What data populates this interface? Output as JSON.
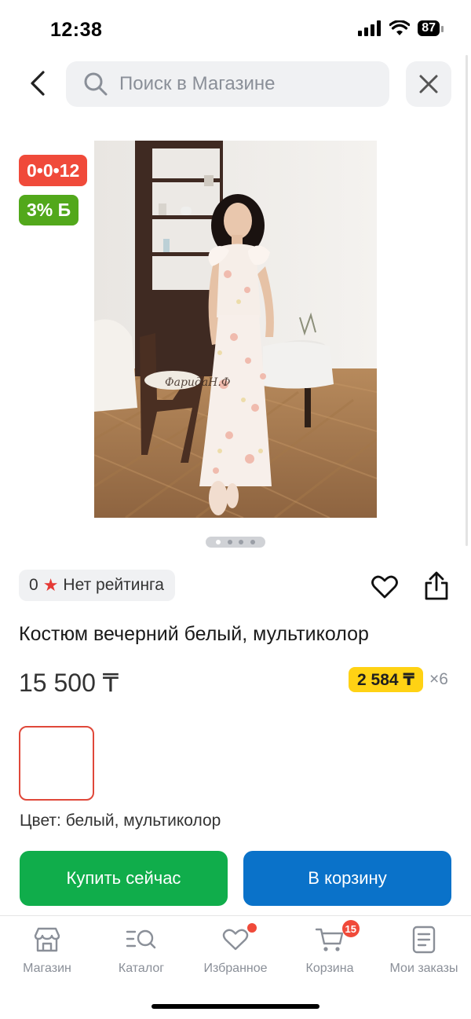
{
  "status_bar": {
    "time": "12:38",
    "battery": "87"
  },
  "search": {
    "placeholder": "Поиск в Магазине"
  },
  "badges": {
    "timer": "0•0•12",
    "bonus": "3% Б"
  },
  "product_image": {
    "watermark": "ФаридаН.Ф",
    "slides_total": 4,
    "active_slide": 1
  },
  "rating": {
    "count": "0",
    "text": "Нет рейтинга"
  },
  "product": {
    "title": "Костюм вечерний белый, мультиколор",
    "price": "15 500 ₸",
    "installment_price": "2 584 ₸",
    "installment_multiplier": "×6",
    "color_label": "Цвет: белый, мультиколор"
  },
  "actions": {
    "buy_now": "Купить сейчас",
    "add_to_cart": "В корзину"
  },
  "nav": {
    "items": [
      {
        "label": "Магазин",
        "icon": "store-icon"
      },
      {
        "label": "Каталог",
        "icon": "catalog-search-icon"
      },
      {
        "label": "Избранное",
        "icon": "heart-icon"
      },
      {
        "label": "Корзина",
        "icon": "cart-icon",
        "badge": "15"
      },
      {
        "label": "Мои заказы",
        "icon": "orders-icon"
      }
    ]
  },
  "colors": {
    "timer_badge": "#f04a3a",
    "bonus_badge": "#52a81b",
    "installment": "#ffd214",
    "buy_button": "#10ad4b",
    "cart_button": "#0a72c9"
  }
}
